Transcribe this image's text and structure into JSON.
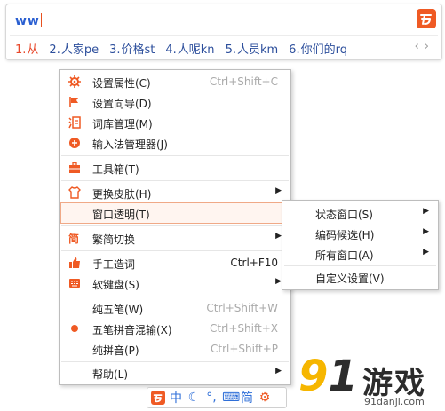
{
  "ime": {
    "input": "ww",
    "candidates": [
      {
        "num": "1.",
        "text": "从"
      },
      {
        "num": "2.",
        "text": "人家pe"
      },
      {
        "num": "3.",
        "text": "价格st"
      },
      {
        "num": "4.",
        "text": "人呢kn"
      },
      {
        "num": "5.",
        "text": "人员km"
      },
      {
        "num": "6.",
        "text": "你们的rq"
      }
    ],
    "prev_page": "‹",
    "next_page": "›"
  },
  "menu": {
    "items": [
      {
        "label": "设置属性(C)",
        "shortcut": "Ctrl+Shift+C",
        "icon": "gear-icon"
      },
      {
        "label": "设置向导(D)",
        "icon": "flag-icon"
      },
      {
        "label": "词库管理(M)",
        "icon": "dictionary-icon"
      },
      {
        "label": "输入法管理器(J)",
        "icon": "manager-icon"
      },
      {
        "label": "工具箱(T)",
        "icon": "toolbox-icon"
      },
      {
        "label": "更换皮肤(H)",
        "icon": "shirt-icon",
        "submenu": true
      },
      {
        "label": "窗口透明(T)",
        "submenu": false
      },
      {
        "label": "繁简切换",
        "icon": "traditional-simplified-icon",
        "submenu": true
      },
      {
        "label": "手工造词",
        "shortcut": "Ctrl+F10",
        "icon": "thumbs-up-icon"
      },
      {
        "label": "软键盘(S)",
        "icon": "soft-keyboard-icon",
        "submenu": true
      },
      {
        "label": "纯五笔(W)",
        "shortcut": "Ctrl+Shift+W"
      },
      {
        "label": "五笔拼音混输(X)",
        "shortcut": "Ctrl+Shift+X",
        "icon": "selected-dot-icon"
      },
      {
        "label": "纯拼音(P)",
        "shortcut": "Ctrl+Shift+P"
      },
      {
        "label": "帮助(L)",
        "submenu": true
      }
    ]
  },
  "submenu": {
    "items": [
      {
        "label": "状态窗口(S)",
        "submenu": true
      },
      {
        "label": "编码候选(H)",
        "submenu": true
      },
      {
        "label": "所有窗口(A)",
        "submenu": true
      },
      {
        "label": "自定义设置(V)"
      }
    ]
  },
  "status_bar": {
    "mode": "中",
    "simplified": "简"
  },
  "watermark": {
    "number_left": "9",
    "number_right": "1",
    "name": "游戏",
    "url": "91danji.com"
  },
  "colors": {
    "accent": "#ef5a24",
    "candidate_text": "#2d4f9c",
    "first_candidate": "#e8472a",
    "highlight_border": "#f0a987"
  }
}
